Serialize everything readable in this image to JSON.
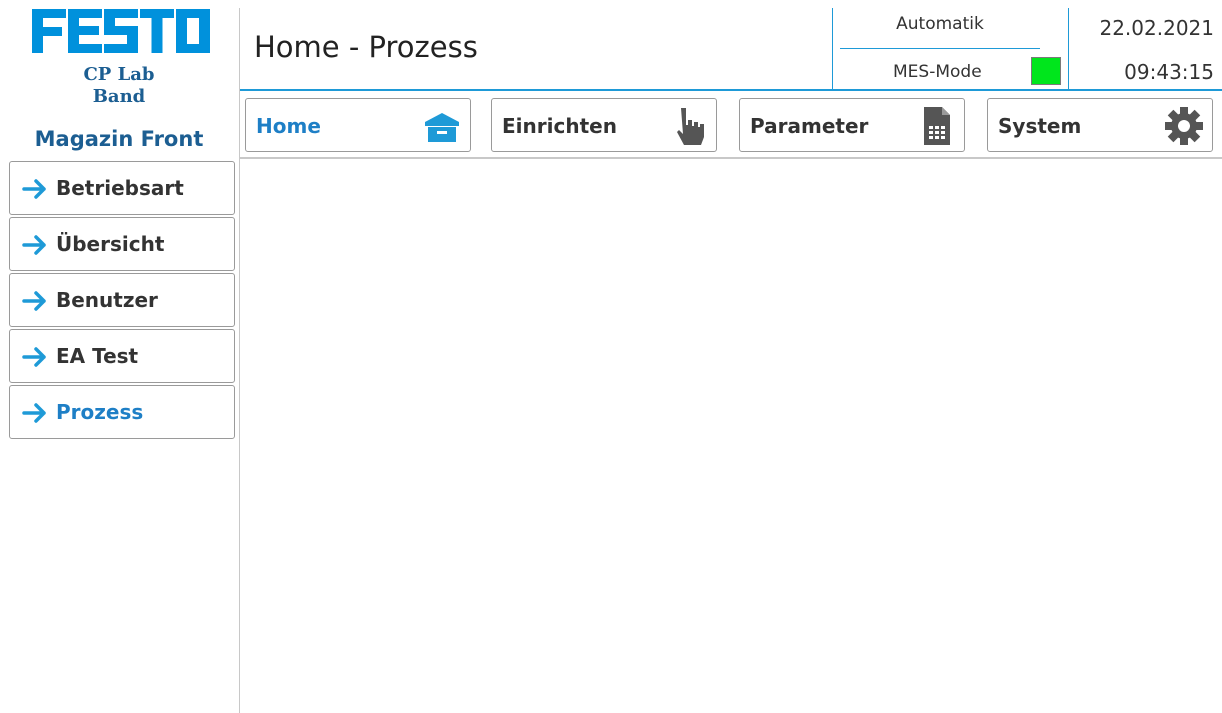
{
  "brand": {
    "logo_text": "FESTO",
    "line1": "CP Lab",
    "line2": "Band",
    "station": "Magazin Front"
  },
  "header": {
    "title": "Home - Prozess",
    "mode": "Automatik",
    "mes_label": "MES-Mode",
    "mes_status_color": "#00e61c",
    "date": "22.02.2021",
    "time": "09:43:15"
  },
  "tabs": [
    {
      "label": "Home",
      "icon": "home-icon",
      "active": true
    },
    {
      "label": "Einrichten",
      "icon": "hand-pointer-icon",
      "active": false
    },
    {
      "label": "Parameter",
      "icon": "document-table-icon",
      "active": false
    },
    {
      "label": "System",
      "icon": "gear-icon",
      "active": false
    }
  ],
  "sidebar": {
    "items": [
      {
        "label": "Betriebsart",
        "icon": "arrow-right-icon",
        "active": false
      },
      {
        "label": "Übersicht",
        "icon": "arrow-right-icon",
        "active": false
      },
      {
        "label": "Benutzer",
        "icon": "arrow-right-icon",
        "active": false
      },
      {
        "label": "EA Test",
        "icon": "arrow-right-icon",
        "active": false
      },
      {
        "label": "Prozess",
        "icon": "arrow-right-icon",
        "active": true
      }
    ]
  },
  "colors": {
    "accent": "#1e9ad7",
    "active_text": "#1e7fc6",
    "brand_text": "#1c5e92"
  }
}
